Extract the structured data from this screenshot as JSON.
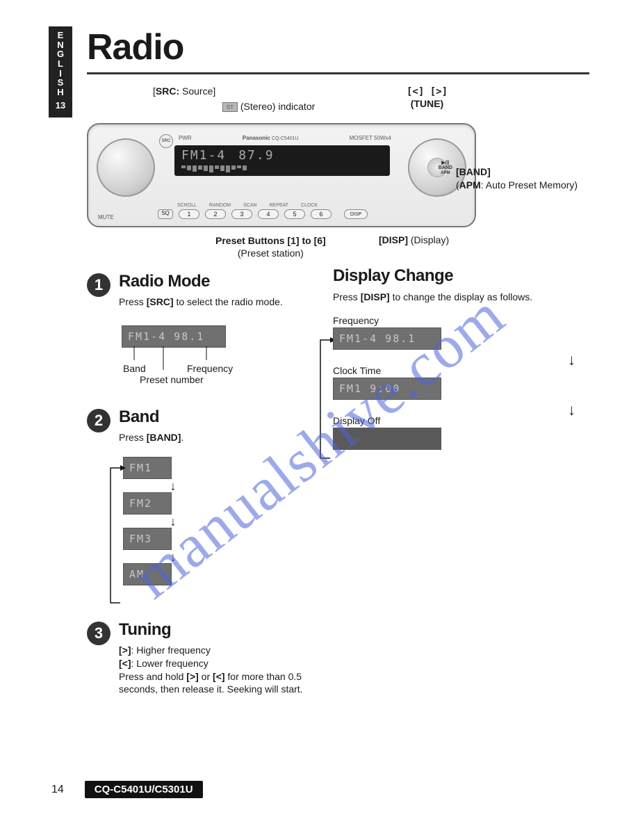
{
  "language_tab": {
    "letters": [
      "E",
      "N",
      "G",
      "L",
      "I",
      "S",
      "H"
    ],
    "page_side": "13"
  },
  "title": "Radio",
  "callouts": {
    "src": {
      "bold": "SRC:",
      "after": " Source"
    },
    "stereo": "(Stereo) indicator",
    "tune_top": "[<] [>]",
    "tune_bottom": "(TUNE)",
    "band": {
      "bold": "[BAND]",
      "sub_bold": "APM",
      "sub_after": ": Auto Preset Memory"
    },
    "preset": {
      "bold": "Preset Buttons [1] to [6]",
      "sub": "(Preset station)"
    },
    "disp": {
      "bold": "[DISP]",
      "after": " (Display)"
    }
  },
  "stereo_face": {
    "brand": "Panasonic",
    "model_small": "CQ-C5401U",
    "mosfet": "MOSFET 50Wx4",
    "src_btn": "SRC",
    "pwr": "PWR",
    "lcd_band": "FM1-4",
    "lcd_freq": "87.9",
    "sq": "SQ",
    "mute": "MUTE",
    "disp": "DISP",
    "preset_nums": [
      "1",
      "2",
      "3",
      "4",
      "5",
      "6"
    ],
    "under_labels": [
      "SCROLL",
      "RANDOM",
      "SCAN",
      "REPEAT",
      "CLOCK"
    ],
    "band_btn": [
      "▶/||",
      "BAND",
      "APM"
    ]
  },
  "s1": {
    "title": "Radio Mode",
    "text_pre": "Press ",
    "text_bold": "[SRC]",
    "text_post": " to select the radio mode.",
    "lcd": "FM1-4  98.1",
    "labels": {
      "band": "Band",
      "preset": "Preset number",
      "freq": "Frequency"
    }
  },
  "s2": {
    "title": "Band",
    "text_pre": "Press ",
    "text_bold": "[BAND]",
    "text_post": ".",
    "chain": [
      "FM1",
      "FM2",
      "FM3",
      "AM"
    ]
  },
  "s3": {
    "title": "Tuning",
    "line1_bold": "[>]",
    "line1_after": ": Higher frequency",
    "line2_bold": "[<]",
    "line2_after": ": Lower frequency",
    "line3_a": "Press and hold ",
    "line3_b1": "[>]",
    "line3_mid": " or ",
    "line3_b2": "[<]",
    "line3_c": " for more than 0.5 seconds, then release it. Seeking will start."
  },
  "s4": {
    "title": "Display Change",
    "text_pre": "Press ",
    "text_bold": "[DISP]",
    "text_post": " to change the display as follows.",
    "steps": [
      {
        "label": "Frequency",
        "lcd": "FM1-4  98.1"
      },
      {
        "label": "Clock Time",
        "lcd": "FM1     9:00"
      },
      {
        "label": "Display Off",
        "lcd": ""
      }
    ]
  },
  "watermark": "manualshive.com",
  "footer": {
    "page": "14",
    "model": "CQ-C5401U/C5301U"
  }
}
